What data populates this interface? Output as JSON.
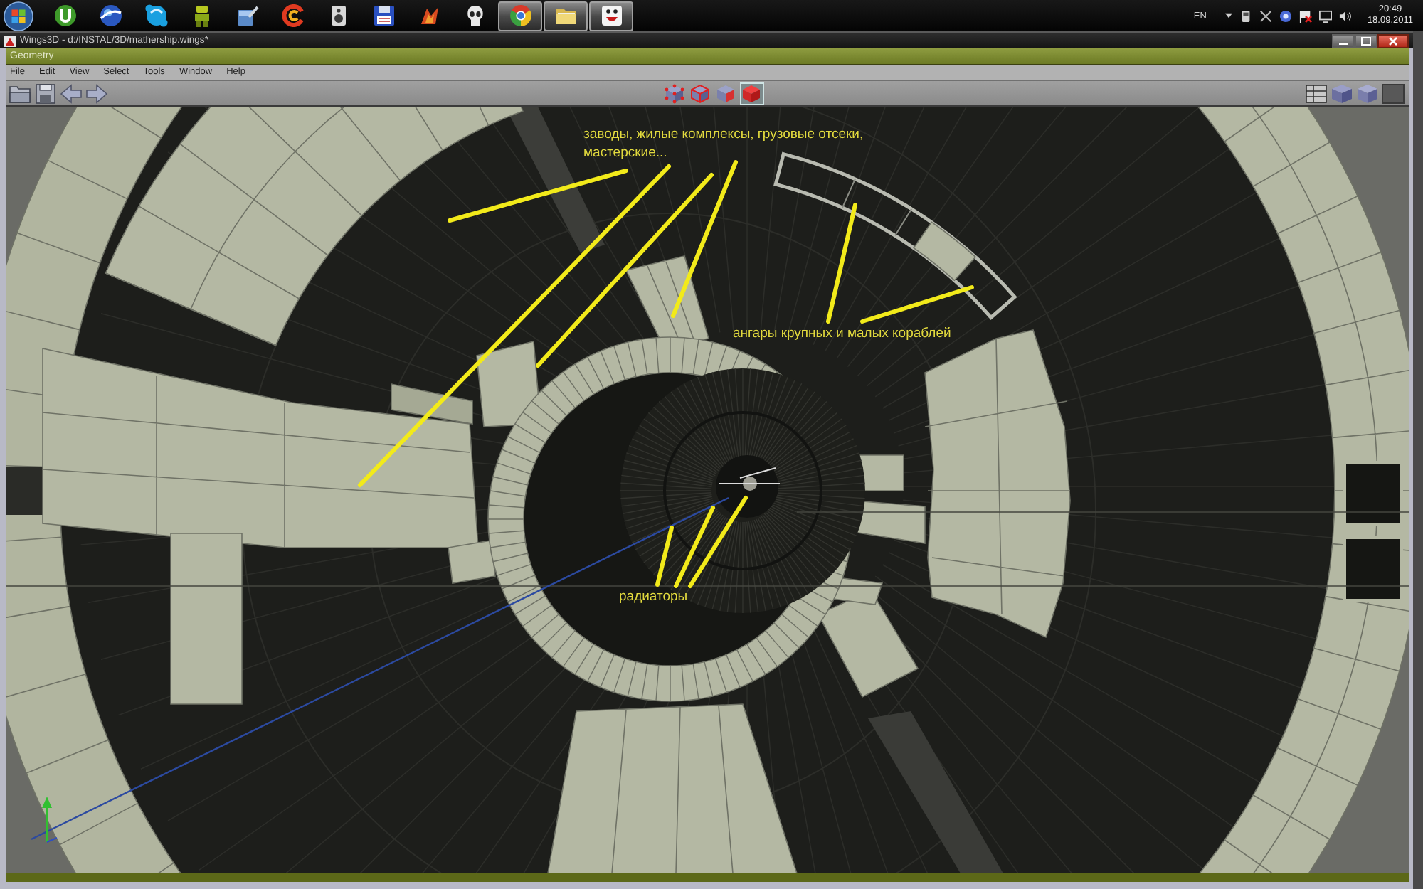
{
  "taskbar": {
    "apps": [
      {
        "kind": "mu-circle",
        "running": false
      },
      {
        "kind": "globe",
        "running": false
      },
      {
        "kind": "cloud",
        "running": false
      },
      {
        "kind": "figure",
        "running": false
      },
      {
        "kind": "toolbox",
        "running": false
      },
      {
        "kind": "swirl",
        "running": false
      },
      {
        "kind": "speaker",
        "running": false
      },
      {
        "kind": "floppy",
        "running": false
      },
      {
        "kind": "flame",
        "running": false
      },
      {
        "kind": "skull",
        "running": false
      },
      {
        "kind": "wheel",
        "running": true
      },
      {
        "kind": "folder",
        "running": true
      },
      {
        "kind": "emblem",
        "running": true
      }
    ],
    "language": "EN",
    "clock": {
      "time": "20:49",
      "date": "18.09.2011"
    }
  },
  "window": {
    "title": "Wings3D - d:/INSTAL/3D/mathership.wings*"
  },
  "geometry_window": {
    "title": "Geometry",
    "menu": [
      "File",
      "Edit",
      "View",
      "Select",
      "Tools",
      "Window",
      "Help"
    ],
    "toolbar": {
      "selection_modes": [
        {
          "kind": "vertex",
          "selected": false
        },
        {
          "kind": "edge",
          "selected": false
        },
        {
          "kind": "face",
          "selected": false
        },
        {
          "kind": "body",
          "selected": true
        }
      ]
    },
    "viewport": {
      "annotations": [
        "заводы, жилые комплексы, грузовые отсеки, мастерские...",
        "ангары крупных и малых кораблей",
        "радиаторы"
      ]
    }
  }
}
